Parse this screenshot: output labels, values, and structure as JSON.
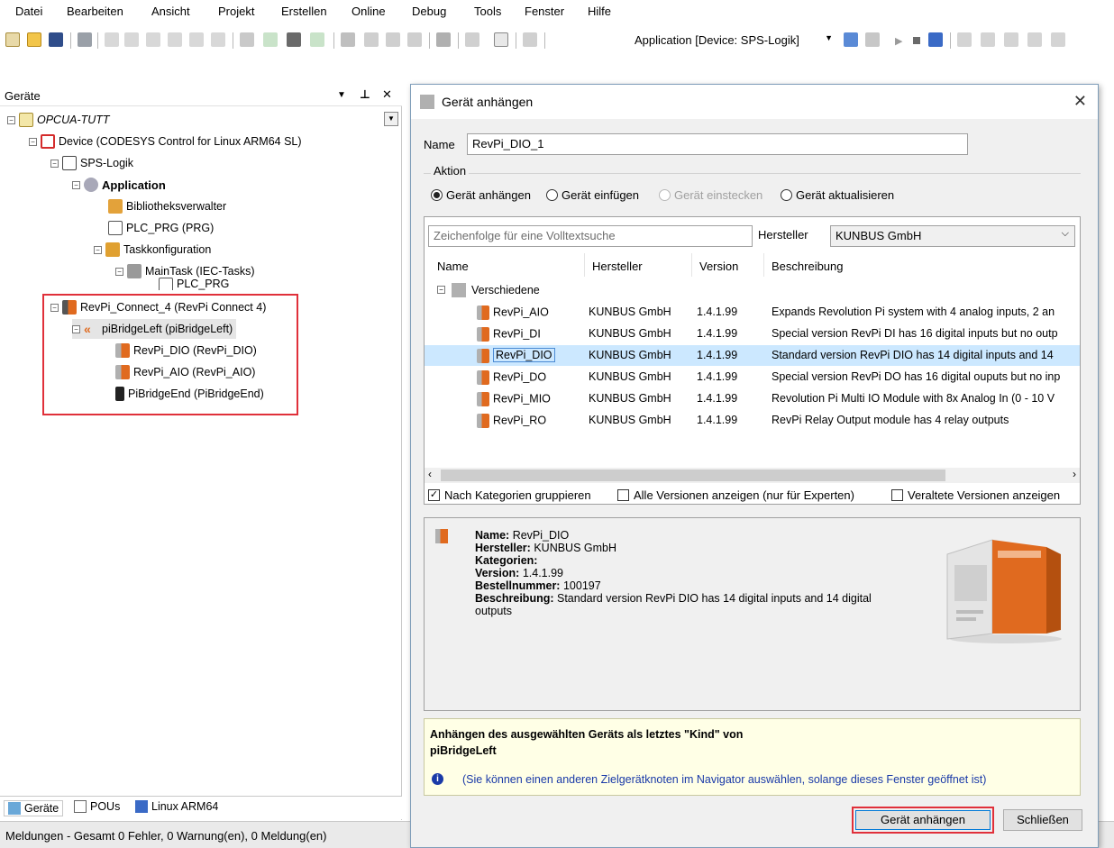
{
  "menubar": {
    "items": [
      "Datei",
      "Bearbeiten",
      "Ansicht",
      "Projekt",
      "Erstellen",
      "Online",
      "Debug",
      "Tools",
      "Fenster",
      "Hilfe"
    ]
  },
  "toolbar": {
    "app_combo": "Application [Device: SPS-Logik]"
  },
  "devices_panel": {
    "title": "Geräte",
    "tree": [
      "OPCUA-TUTT",
      "Device (CODESYS Control for Linux ARM64 SL)",
      "SPS-Logik",
      "Application",
      "Bibliotheksverwalter",
      "PLC_PRG (PRG)",
      "Taskkonfiguration",
      "MainTask (IEC-Tasks)",
      "PLC_PRG",
      "RevPi_Connect_4 (RevPi Connect 4)",
      "piBridgeLeft (piBridgeLeft)",
      "RevPi_DIO (RevPi_DIO)",
      "RevPi_AIO (RevPi_AIO)",
      "PiBridgeEnd (PiBridgeEnd)"
    ],
    "bottom_tabs": [
      "Geräte",
      "POUs",
      "Linux ARM64"
    ]
  },
  "status_bar": {
    "text": "Meldungen - Gesamt 0 Fehler, 0 Warnung(en), 0 Meldung(en)"
  },
  "dialog": {
    "title": "Gerät anhängen",
    "name_label": "Name",
    "name_value": "RevPi_DIO_1",
    "action_group": "Aktion",
    "radios": [
      "Gerät anhängen",
      "Gerät einfügen",
      "Gerät einstecken",
      "Gerät aktualisieren"
    ],
    "search_placeholder": "Zeichenfolge für eine Volltextsuche",
    "vendor_label": "Hersteller",
    "vendor_value": "KUNBUS GmbH",
    "columns": [
      "Name",
      "Hersteller",
      "Version",
      "Beschreibung"
    ],
    "category": "Verschiedene",
    "rows": [
      {
        "name": "RevPi_AIO",
        "vendor": "KUNBUS GmbH",
        "version": "1.4.1.99",
        "desc": "Expands Revolution Pi system with 4 analog inputs, 2 an"
      },
      {
        "name": "RevPi_DI",
        "vendor": "KUNBUS GmbH",
        "version": "1.4.1.99",
        "desc": "Special version RevPi DI has 16 digital inputs but no outp"
      },
      {
        "name": "RevPi_DIO",
        "vendor": "KUNBUS GmbH",
        "version": "1.4.1.99",
        "desc": "Standard version RevPi DIO has 14 digital inputs and 14"
      },
      {
        "name": "RevPi_DO",
        "vendor": "KUNBUS GmbH",
        "version": "1.4.1.99",
        "desc": "Special version RevPi DO has 16 digital ouputs but no inp"
      },
      {
        "name": "RevPi_MIO",
        "vendor": "KUNBUS GmbH",
        "version": "1.4.1.99",
        "desc": "Revolution Pi Multi IO Module with 8x Analog In (0 - 10 V"
      },
      {
        "name": "RevPi_RO",
        "vendor": "KUNBUS GmbH",
        "version": "1.4.1.99",
        "desc": "RevPi Relay Output module has 4 relay outputs"
      }
    ],
    "checks": [
      "Nach Kategorien gruppieren",
      "Alle Versionen anzeigen (nur für Experten)",
      "Veraltete Versionen anzeigen"
    ],
    "info": {
      "name_label": "Name:",
      "name_value": "RevPi_DIO",
      "vendor_label": "Hersteller:",
      "vendor_value": "KUNBUS GmbH",
      "cat_label": "Kategorien:",
      "version_label": "Version:",
      "version_value": "1.4.1.99",
      "order_label": "Bestellnummer:",
      "order_value": "100197",
      "desc_label": "Beschreibung:",
      "desc_value": "Standard version RevPi DIO has 14 digital inputs and 14 digital",
      "desc_value2": "outputs"
    },
    "hint_title_1": "Anhängen des ausgewählten Geräts als letztes \"Kind\" von",
    "hint_title_2": "piBridgeLeft",
    "hint_text": "(Sie können einen anderen Zielgerätknoten im Navigator auswählen, solange dieses Fenster geöffnet ist)",
    "btn_attach": "Gerät anhängen",
    "btn_close": "Schließen"
  }
}
